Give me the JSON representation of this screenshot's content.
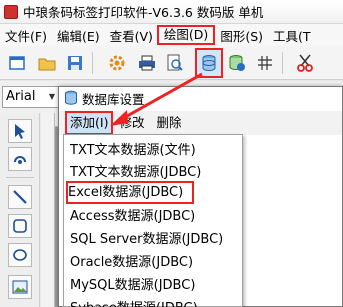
{
  "window": {
    "title": "中琅条码标签打印软件-V6.3.6 数码版 单机"
  },
  "menubar": {
    "items": [
      "文件(F)",
      "编辑(E)",
      "查看(V)",
      "绘图(D)",
      "图形(S)",
      "工具(T"
    ]
  },
  "toolbar": {
    "icons": [
      "new-icon",
      "open-icon",
      "save-icon",
      "settings-icon",
      "print-icon",
      "print-preview-icon",
      "database-icon",
      "database-check-icon",
      "grid-icon",
      "cut-icon"
    ]
  },
  "font": {
    "name": "Arial"
  },
  "dialog": {
    "title": "数据库设置",
    "menu": {
      "add": "添加(I)",
      "edit": "修改",
      "delete": "删除"
    }
  },
  "dropdown": {
    "items": [
      "TXT文本数据源(文件)",
      "TXT文本数据源(JDBC)",
      "Excel数据源(JDBC)",
      "Access数据源(JDBC)",
      "SQL Server数据源(JDBC)",
      "Oracle数据源(JDBC)",
      "MySQL数据源(JDBC)",
      "Sybase数据源(JDBC)"
    ]
  },
  "colors": {
    "highlight": "#ee2222",
    "accent": "#2a6cc4"
  }
}
